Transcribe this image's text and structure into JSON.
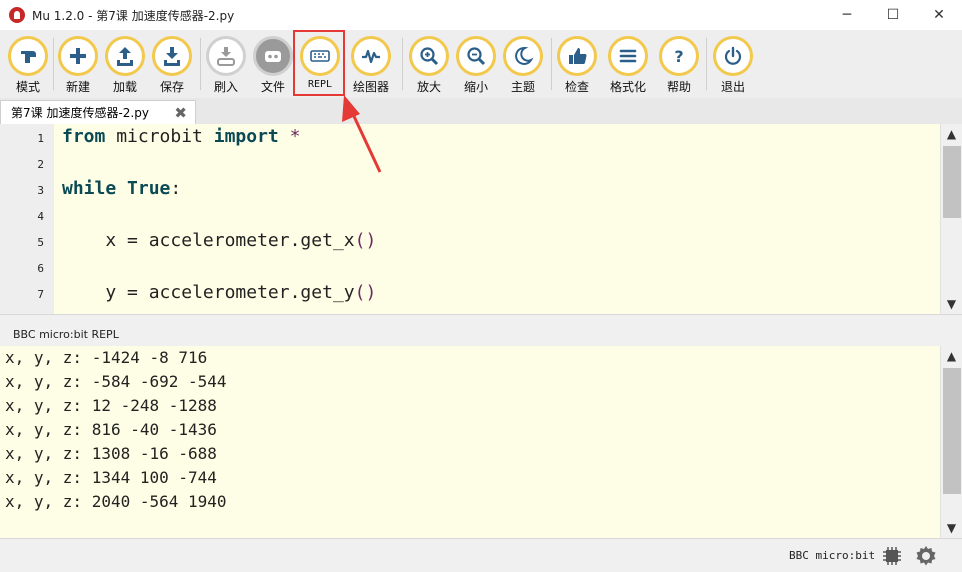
{
  "window": {
    "title": "Mu 1.2.0 - 第7课 加速度传感器-2.py",
    "minimize": "─",
    "maximize": "☐",
    "close": "✕"
  },
  "toolbar": {
    "buttons": [
      {
        "id": "mode",
        "label": "模式",
        "icon": "mode-icon"
      },
      {
        "id": "new",
        "label": "新建",
        "icon": "plus-icon"
      },
      {
        "id": "load",
        "label": "加载",
        "icon": "upload-icon"
      },
      {
        "id": "save",
        "label": "保存",
        "icon": "download-icon"
      },
      {
        "id": "flash",
        "label": "刷入",
        "icon": "flash-icon"
      },
      {
        "id": "files",
        "label": "文件",
        "icon": "files-icon"
      },
      {
        "id": "repl",
        "label": "REPL",
        "icon": "keyboard-icon"
      },
      {
        "id": "plotter",
        "label": "绘图器",
        "icon": "waveform-icon"
      },
      {
        "id": "zoom_in",
        "label": "放大",
        "icon": "zoom-in-icon"
      },
      {
        "id": "zoom_out",
        "label": "缩小",
        "icon": "zoom-out-icon"
      },
      {
        "id": "theme",
        "label": "主题",
        "icon": "moon-icon"
      },
      {
        "id": "check",
        "label": "检查",
        "icon": "thumbs-up-icon"
      },
      {
        "id": "tidy",
        "label": "格式化",
        "icon": "lines-icon"
      },
      {
        "id": "help",
        "label": "帮助",
        "icon": "question-icon"
      },
      {
        "id": "quit",
        "label": "退出",
        "icon": "power-icon"
      }
    ],
    "accent_color": "#f2c94c",
    "highlight_color": "#e53935"
  },
  "tab": {
    "label": "第7课 加速度传感器-2.py",
    "close": "✖"
  },
  "editor": {
    "line_numbers": [
      "1",
      "2",
      "3",
      "4",
      "5",
      "6",
      "7"
    ],
    "lines": [
      {
        "kw1": "from",
        "rest1": " microbit ",
        "kw2": "import",
        "rest2": " *"
      },
      {
        "text": ""
      },
      {
        "kw1": "while",
        "rest1": " ",
        "kw2": "True",
        "rest2": ":"
      },
      {
        "text": ""
      },
      {
        "indent": "    ",
        "var": "x",
        "op": " = ",
        "call": "accelerometer.get_x",
        "paren": "()"
      },
      {
        "text": ""
      },
      {
        "indent": "    ",
        "var": "y",
        "op": " = ",
        "call": "accelerometer.get_y",
        "paren": "()"
      }
    ],
    "background": "#fefee6"
  },
  "repl": {
    "title": "BBC micro:bit REPL",
    "lines": [
      "x, y, z: -1424 -8 716",
      "x, y, z: -584 -692 -544",
      "x, y, z: 12 -248 -1288",
      "x, y, z: 816 -40 -1436",
      "x, y, z: 1308 -16 -688",
      "x, y, z: 1344 100 -744",
      "x, y, z: 2040 -564 1940"
    ]
  },
  "scroll": {
    "up": "▲",
    "down": "▼"
  },
  "status": {
    "mode": "BBC micro:bit"
  }
}
